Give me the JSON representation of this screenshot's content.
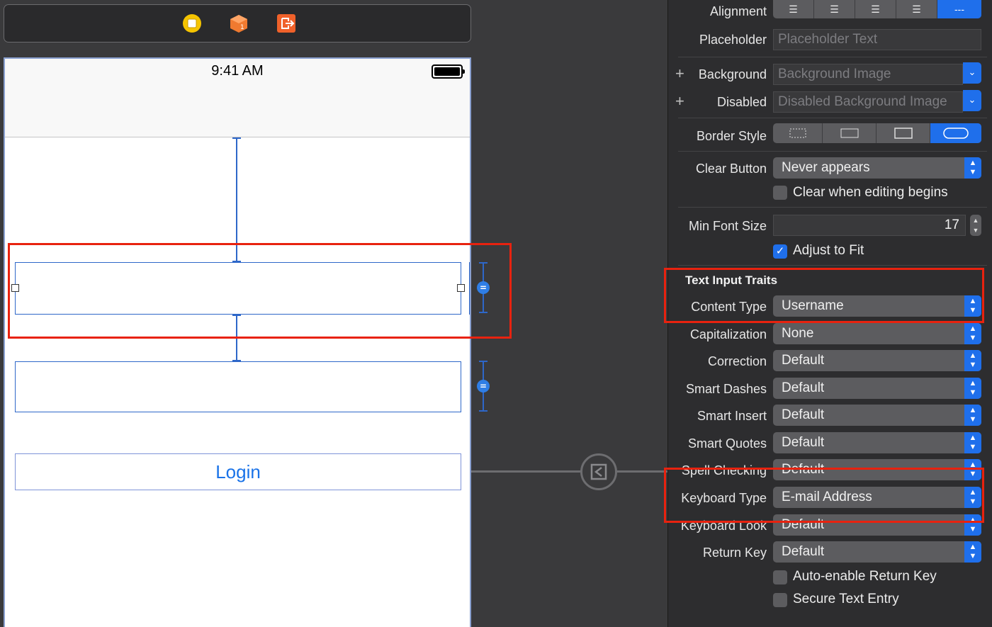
{
  "colors": {
    "accent": "#1f6feb",
    "highlight": "#e8220f",
    "constraint": "#2e67c9"
  },
  "canvas": {
    "toolbar": {
      "icons": [
        "view-controller-icon",
        "first-responder-icon",
        "exit-icon"
      ]
    },
    "status_bar": {
      "time": "9:41 AM",
      "battery_level": 1.0
    },
    "login_button": {
      "label": "Login"
    }
  },
  "inspector": {
    "alignment": {
      "label": "Alignment",
      "options": [
        "left",
        "center",
        "right",
        "justified",
        "natural"
      ],
      "selected": 4,
      "selected_glyph": "---"
    },
    "placeholder": {
      "label": "Placeholder",
      "value": "Placeholder Text"
    },
    "background": {
      "label": "Background",
      "value": "Background Image"
    },
    "disabled": {
      "label": "Disabled",
      "value": "Disabled Background Image"
    },
    "border_style": {
      "label": "Border Style",
      "options": [
        "none",
        "line",
        "bezel",
        "rounded"
      ],
      "selected": 3
    },
    "clear_button": {
      "label": "Clear Button",
      "value": "Never appears"
    },
    "clear_when_editing": {
      "label": "Clear when editing begins",
      "checked": false
    },
    "min_font_size": {
      "label": "Min Font Size",
      "value": "17"
    },
    "adjust_to_fit": {
      "label": "Adjust to Fit",
      "checked": true
    },
    "text_input_traits": {
      "title": "Text Input Traits",
      "content_type": {
        "label": "Content Type",
        "value": "Username"
      },
      "capitalization": {
        "label": "Capitalization",
        "value": "None"
      },
      "correction": {
        "label": "Correction",
        "value": "Default"
      },
      "smart_dashes": {
        "label": "Smart Dashes",
        "value": "Default"
      },
      "smart_insert": {
        "label": "Smart Insert",
        "value": "Default"
      },
      "smart_quotes": {
        "label": "Smart Quotes",
        "value": "Default"
      },
      "spell_checking": {
        "label": "Spell Checking",
        "value": "Default"
      },
      "keyboard_type": {
        "label": "Keyboard Type",
        "value": "E-mail Address"
      },
      "keyboard_look": {
        "label": "Keyboard Look",
        "value": "Default"
      },
      "return_key": {
        "label": "Return Key",
        "value": "Default"
      },
      "auto_enable_return": {
        "label": "Auto-enable Return Key",
        "checked": false
      },
      "secure_text_entry": {
        "label": "Secure Text Entry",
        "checked": false
      }
    },
    "glyphs": {
      "plus": "+",
      "chevron_down": "⌄",
      "stepper": "▲\n▼",
      "check": "✓",
      "equal": "="
    }
  }
}
